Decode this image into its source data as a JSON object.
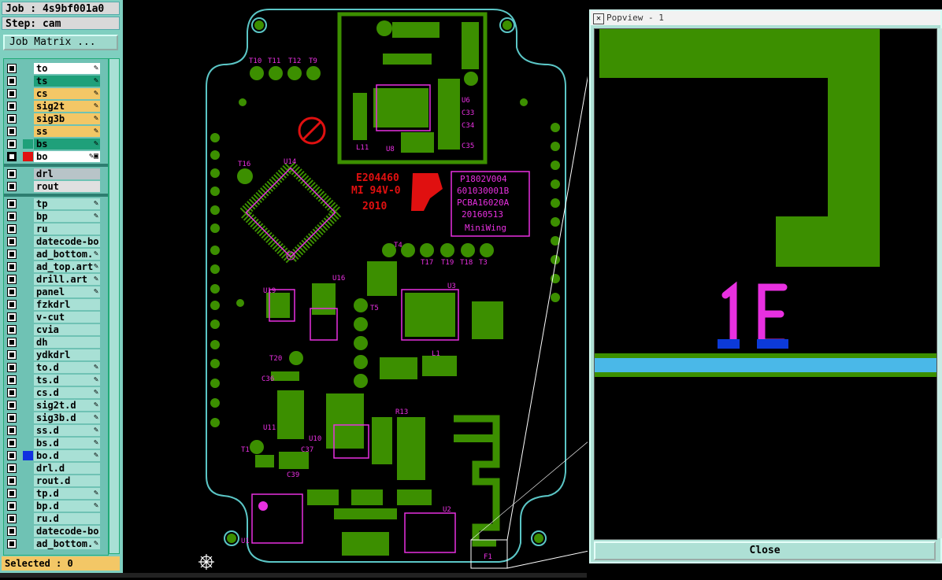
{
  "job": {
    "label": "Job : 4s9bf001a0",
    "step": "Step: cam",
    "matrix_btn": "Job Matrix ..."
  },
  "layers": [
    {
      "name": "to",
      "color": "#ffffff",
      "flag": "✎"
    },
    {
      "name": "ts",
      "color": "#1fa07a",
      "flag": "✎"
    },
    {
      "name": "cs",
      "color": "#f3c766",
      "flag": "✎"
    },
    {
      "name": "sig2t",
      "color": "#f3c766",
      "flag": "✎"
    },
    {
      "name": "sig3b",
      "color": "#f3c766",
      "flag": "✎"
    },
    {
      "name": "ss",
      "color": "#f3c766",
      "flag": "✎"
    },
    {
      "name": "bs",
      "color": "#1fa07a",
      "flag": "✎"
    },
    {
      "name": "bo",
      "color": "#ffffff",
      "flag": "✎▣"
    }
  ],
  "drill_layers": [
    {
      "name": "drl",
      "color": "#b8c4c8"
    },
    {
      "name": "rout",
      "color": "#e0e0e0"
    }
  ],
  "misc_layers": [
    {
      "name": "tp",
      "flag": "✎"
    },
    {
      "name": "bp",
      "flag": "✎"
    },
    {
      "name": "ru",
      "flag": ""
    },
    {
      "name": "datecode-bo",
      "flag": ""
    },
    {
      "name": "ad_bottom.",
      "flag": "✎"
    },
    {
      "name": "ad_top.art",
      "flag": "✎"
    },
    {
      "name": "drill.art",
      "flag": "✎"
    },
    {
      "name": "panel",
      "flag": "✎"
    },
    {
      "name": "fzkdrl",
      "flag": ""
    },
    {
      "name": "v-cut",
      "flag": ""
    },
    {
      "name": "cvia",
      "flag": ""
    },
    {
      "name": "dh",
      "flag": ""
    },
    {
      "name": "ydkdrl",
      "flag": ""
    },
    {
      "name": "to.d",
      "flag": "✎"
    },
    {
      "name": "ts.d",
      "flag": "✎"
    },
    {
      "name": "cs.d",
      "flag": "✎"
    },
    {
      "name": "sig2t.d",
      "flag": "✎"
    },
    {
      "name": "sig3b.d",
      "flag": "✎"
    },
    {
      "name": "ss.d",
      "flag": "✎"
    },
    {
      "name": "bs.d",
      "flag": "✎"
    },
    {
      "name": "bo.d",
      "flag": "✎"
    },
    {
      "name": "drl.d",
      "flag": ""
    },
    {
      "name": "rout.d",
      "flag": ""
    },
    {
      "name": "tp.d",
      "flag": "✎"
    },
    {
      "name": "bp.d",
      "flag": "✎"
    },
    {
      "name": "ru.d",
      "flag": ""
    },
    {
      "name": "datecode-bo",
      "flag": ""
    },
    {
      "name": "ad_bottom.",
      "flag": "✎"
    }
  ],
  "status": "Selected : 0",
  "board_text": {
    "code1": "E204460",
    "code2": "MI 94V-0",
    "code3": "2010",
    "info": [
      "P1802V004",
      "601030001B",
      "PCBA16020A",
      "20160513",
      "MiniWing"
    ],
    "refs": [
      "T16",
      "T11",
      "T12",
      "T9",
      "T10",
      "U14",
      "T17",
      "T19",
      "T18",
      "T3",
      "T4",
      "U3",
      "U19",
      "U16",
      "T5",
      "T20",
      "U11",
      "U10",
      "U2",
      "U8",
      "U1",
      "L11",
      "C33",
      "C34",
      "C35",
      "U6",
      "T1",
      "R13",
      "C39",
      "C36",
      "C37",
      "L1",
      "F1"
    ]
  },
  "popup": {
    "title": "Popview - 1",
    "label": "E1",
    "close": "Close"
  },
  "colors": {
    "copper": "#3c8f00",
    "silk": "#e830e0",
    "outline": "#5bc6c6",
    "marking": "#e01010",
    "panel": "#7fcfc0"
  }
}
